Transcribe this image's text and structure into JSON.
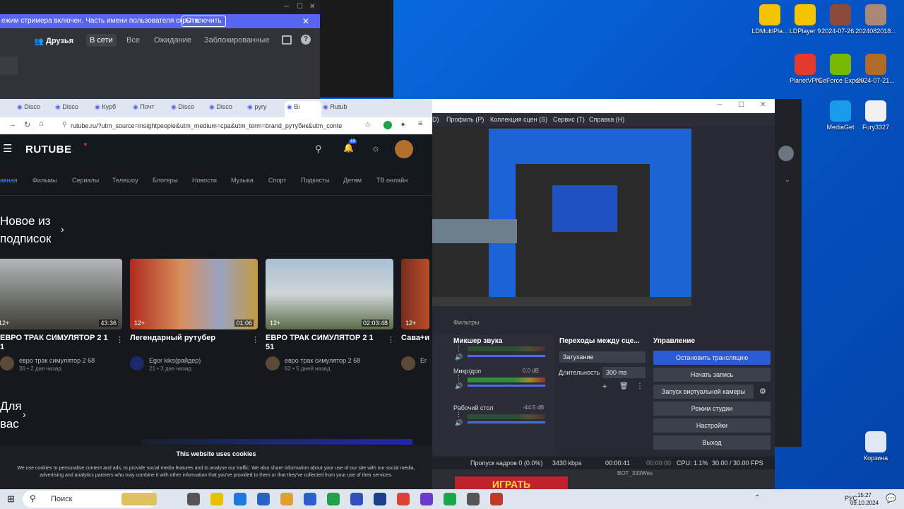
{
  "desktop": {
    "icons": [
      {
        "label": "LDMultiPla...",
        "color": "#f5c400"
      },
      {
        "label": "LDPlayer 9",
        "color": "#f5c400"
      },
      {
        "label": "2024-07-26...",
        "color": "#8b4a3a"
      },
      {
        "label": "2024082018...",
        "color": "#aa8877"
      },
      {
        "label": "PlanetVPN",
        "color": "#e23b2e"
      },
      {
        "label": "GeForce Experience",
        "color": "#76b900"
      },
      {
        "label": "2024-07-21...",
        "color": "#b06a2a"
      },
      {
        "label": "MediaGet",
        "color": "#1a9be8"
      },
      {
        "label": "Fury3327",
        "color": "#f1f1f1"
      },
      {
        "label": "Корзина",
        "color": "#dfe8f2"
      }
    ]
  },
  "discord": {
    "banner_text": "ежим стримера включен. Часть имени пользователя скрыта.",
    "banner_button": "Отключить",
    "friends_label": "Друзья",
    "tabs": [
      "В сети",
      "Все",
      "Ожидание",
      "Заблокированные"
    ]
  },
  "browser": {
    "tabs": [
      "Disco",
      "Disco",
      "Курб",
      "Почт",
      "Disco",
      "Disco",
      "pyry",
      "Bi",
      "Rutub"
    ],
    "url": "rutube.ru/?utm_source=insightpeople&utm_medium=cpa&utm_term=brand_рутубик&utm_conte",
    "logo": "RUTUBE",
    "notif_count": "19",
    "nav": [
      "авная",
      "Фильмы",
      "Сериалы",
      "Телешоу",
      "Блогеры",
      "Новости",
      "Музыка",
      "Спорт",
      "Подкасты",
      "Детям",
      "ТВ онлайн"
    ],
    "section1": [
      "Новое из",
      "подписок"
    ],
    "section2": [
      "Для",
      "вас"
    ],
    "videos": [
      {
        "title": "ЕВРО ТРАК СИМУЛЯТОР 2 1 1",
        "channel": "евро трак симулятор 2 68",
        "meta": "36 • 2 дня назад",
        "age": "12+",
        "duration": "43:36"
      },
      {
        "title": "Легендарный рутубер",
        "channel": "Egor kiks(райдер)",
        "meta": "21 • 3 дня назад",
        "age": "12+",
        "duration": "01:06"
      },
      {
        "title": "ЕВРО ТРАК СИМУЛЯТОР 2 1 51",
        "channel": "евро трак симулятор 2 68",
        "meta": "62 • 5 дней назад",
        "age": "12+",
        "duration": "02:03:48"
      },
      {
        "title": "Сава+и",
        "channel": "Ег",
        "meta": "",
        "age": "12+",
        "duration": ""
      }
    ],
    "cookie_title": "This website uses cookies",
    "cookie_text": "We use cookies to personalise content and ads, to provide social media features and to analyse our traffic. We also share information about your use of our site with our social media, advertising and analytics partners who may combine it with other information that you've provided to them or that they've collected from your use of their services."
  },
  "obs": {
    "menu": [
      "D)",
      "Профиль (P)",
      "Коллекция сцен (S)",
      "Сервис (T)",
      "Справка (H)"
    ],
    "filters_label": "Фильтры",
    "mixer_title": "Микшер звука",
    "transitions_title": "Переходы между сце...",
    "controls_title": "Управление",
    "mixer": [
      {
        "name": "",
        "level": ""
      },
      {
        "name": "Микр/доп",
        "level": "0.0 dB"
      },
      {
        "name": "Рабочий стол",
        "level": "-44.5 dB"
      }
    ],
    "transition": "Затухание",
    "duration_label": "Длительность",
    "duration_value": "300 ms",
    "controls": [
      "Остановить трансляцию",
      "Начать запись",
      "Запуск виртуальной камеры",
      "Режим студии",
      "Настройки",
      "Выход"
    ],
    "status": {
      "dropped": "Пропуск кадров 0 (0.0%)",
      "bitrate": "3430 kbps",
      "stream_time": "00:00:41",
      "rec_time": "00:00:00",
      "cpu": "CPU: 1.1%",
      "fps": "30.00 / 30.00 FPS"
    },
    "under_label": "ИГРАТЬ",
    "under_text": "BOT_333Wes"
  },
  "taskbar": {
    "search_placeholder": "Поиск",
    "lang": "РУС",
    "time": "15:27",
    "date": "09.10.2024"
  }
}
